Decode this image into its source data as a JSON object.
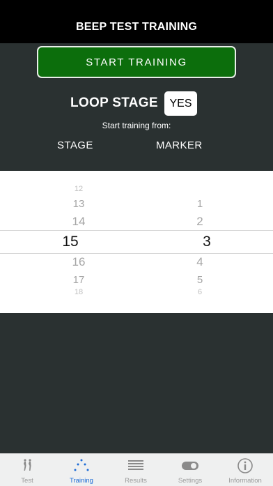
{
  "header": {
    "title": "BEEP TEST TRAINING"
  },
  "start_button": {
    "label": "START TRAINING"
  },
  "loop": {
    "label": "LOOP STAGE",
    "value": "YES"
  },
  "start_from_text": "Start training from:",
  "columns": {
    "stage": "STAGE",
    "marker": "MARKER"
  },
  "stage_picker": {
    "above": [
      "12",
      "13",
      "14"
    ],
    "selected": "15",
    "below": [
      "16",
      "17",
      "18"
    ]
  },
  "marker_picker": {
    "above": [
      "1",
      "2"
    ],
    "selected": "3",
    "below": [
      "4",
      "5",
      "6"
    ]
  },
  "tabs": [
    {
      "label": "Test",
      "icon": "runners-icon",
      "active": false
    },
    {
      "label": "Training",
      "icon": "training-cones-icon",
      "active": true
    },
    {
      "label": "Results",
      "icon": "list-icon",
      "active": false
    },
    {
      "label": "Settings",
      "icon": "toggle-icon",
      "active": false
    },
    {
      "label": "Information",
      "icon": "info-icon",
      "active": false
    }
  ],
  "colors": {
    "accent_green": "#0c6e0c",
    "tab_active": "#1c6bd6",
    "background": "#2a3131"
  }
}
